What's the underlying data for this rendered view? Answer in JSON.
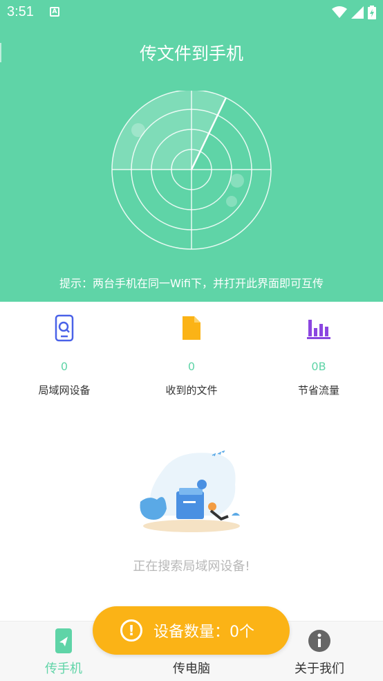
{
  "status_bar": {
    "time": "3:51",
    "app_icon_letter": "A"
  },
  "header": {
    "title": "传文件到手机",
    "hint": "提示：两台手机在同一Wifi下，并打开此界面即可互传",
    "bg_color": "#5fd4a7"
  },
  "stats": [
    {
      "icon": "phone-search-icon",
      "value": "0",
      "label": "局域网设备"
    },
    {
      "icon": "file-icon",
      "value": "0",
      "label": "收到的文件"
    },
    {
      "icon": "bar-chart-icon",
      "value": "0B",
      "label": "节省流量"
    }
  ],
  "empty_state": {
    "text": "正在搜索局域网设备!"
  },
  "toast": {
    "text": "设备数量：0个",
    "color": "#fbb316"
  },
  "bottom_nav": [
    {
      "label": "传手机",
      "icon": "send-phone-icon",
      "active": true
    },
    {
      "label": "传电脑",
      "icon": "computer-icon",
      "active": false
    },
    {
      "label": "关于我们",
      "icon": "info-icon",
      "active": false
    }
  ]
}
